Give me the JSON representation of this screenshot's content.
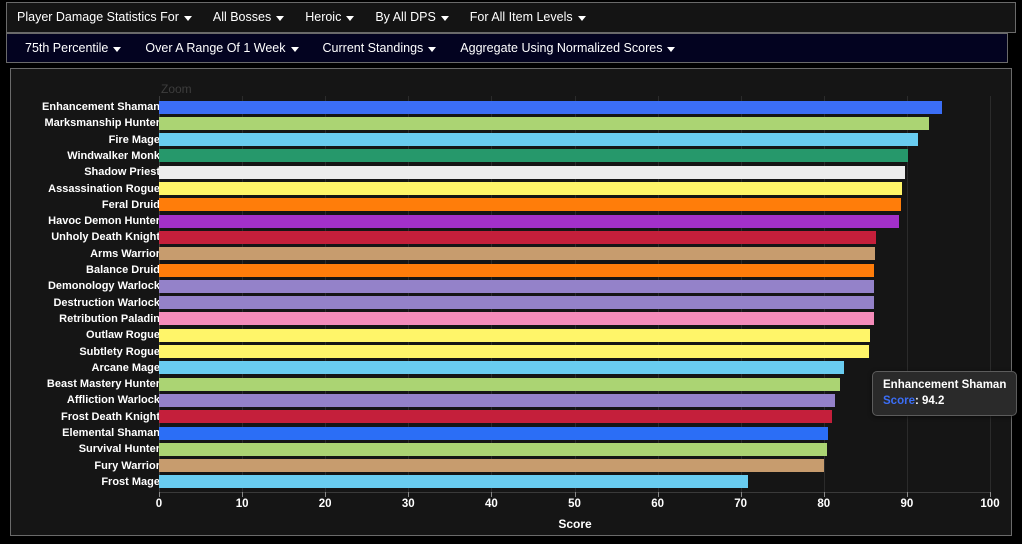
{
  "toolbars": {
    "primary": [
      {
        "label": "Player Damage Statistics For",
        "caret": "chevron-down-icon"
      },
      {
        "label": "All Bosses",
        "caret": "chevron-down-icon"
      },
      {
        "label": "Heroic",
        "caret": "chevron-down-icon"
      },
      {
        "label": "By All DPS",
        "caret": "chevron-down-icon"
      },
      {
        "label": "For All Item Levels",
        "caret": "chevron-down-icon"
      }
    ],
    "secondary": [
      {
        "label": "75th Percentile",
        "caret": "chevron-down-icon"
      },
      {
        "label": "Over A Range Of 1 Week",
        "caret": "chevron-down-icon"
      },
      {
        "label": "Current Standings",
        "caret": "chevron-down-icon"
      },
      {
        "label": "Aggregate Using Normalized Scores",
        "caret": "chevron-down-icon"
      }
    ]
  },
  "chart_panel": {
    "zoom_label": "Zoom"
  },
  "tooltip": {
    "title": "Enhancement Shaman",
    "key": "Score",
    "separator": ": ",
    "value": "94.2"
  },
  "chart_data": {
    "type": "bar",
    "orientation": "horizontal",
    "title": "",
    "xlabel": "Score",
    "ylabel": "",
    "xlim": [
      0,
      100
    ],
    "xticks": [
      0,
      10,
      20,
      30,
      40,
      50,
      60,
      70,
      80,
      90,
      100
    ],
    "grid": true,
    "legend": "none",
    "categories": [
      "Enhancement Shaman",
      "Marksmanship Hunter",
      "Fire Mage",
      "Windwalker Monk",
      "Shadow Priest",
      "Assassination Rogue",
      "Feral Druid",
      "Havoc Demon Hunter",
      "Unholy Death Knight",
      "Arms Warrior",
      "Balance Druid",
      "Demonology Warlock",
      "Destruction Warlock",
      "Retribution Paladin",
      "Outlaw Rogue",
      "Subtlety Rogue",
      "Arcane Mage",
      "Beast Mastery Hunter",
      "Affliction Warlock",
      "Frost Death Knight",
      "Elemental Shaman",
      "Survival Hunter",
      "Fury Warrior",
      "Frost Mage"
    ],
    "values": [
      94.2,
      92.7,
      91.3,
      90.1,
      89.8,
      89.4,
      89.3,
      89.0,
      86.3,
      86.2,
      86.1,
      86.1,
      86.1,
      86.0,
      85.5,
      85.4,
      82.4,
      81.9,
      81.4,
      81.0,
      80.5,
      80.4,
      80.0,
      70.9
    ],
    "colors": [
      "#3b6ef6",
      "#abd473",
      "#69ccf0",
      "#26986b",
      "#ececec",
      "#fff569",
      "#ff7d0a",
      "#a330c9",
      "#c41f3b",
      "#c79c6e",
      "#ff7d0a",
      "#9482c9",
      "#9482c9",
      "#f58cba",
      "#fff569",
      "#fff569",
      "#69ccf0",
      "#abd473",
      "#9482c9",
      "#c41f3b",
      "#2b6ef6",
      "#abd473",
      "#c79c6e",
      "#69ccf0"
    ]
  },
  "theme": {
    "background": "#000000",
    "panel_background": "#151515",
    "panel_border": "#6a6a6a",
    "toolbar_primary_background": "#141414",
    "toolbar_secondary_background": "#030320",
    "text": "#ffffff",
    "gridline": "#2b2b2b",
    "tooltip_background": "#2a2a2a",
    "tooltip_accent": "#3b6ef6"
  }
}
